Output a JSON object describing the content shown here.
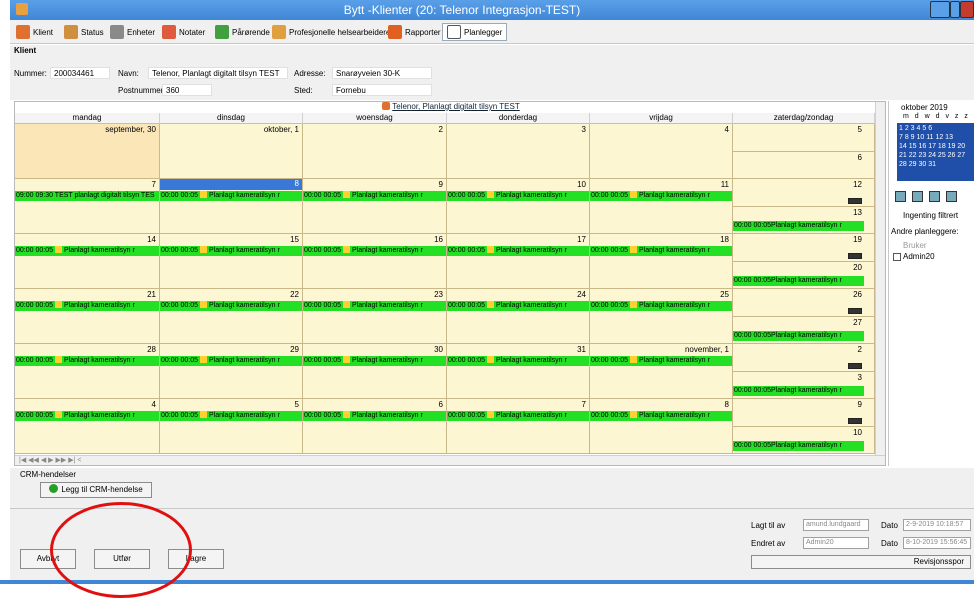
{
  "window": {
    "title": "Bytt -Klienter (20: Telenor Integrasjon-TEST)"
  },
  "tabs": [
    {
      "label": "Klient",
      "icon": "person-icon"
    },
    {
      "label": "Status",
      "icon": "status-icon"
    },
    {
      "label": "Enheter",
      "icon": "devices-icon"
    },
    {
      "label": "Notater",
      "icon": "notes-icon"
    },
    {
      "label": "Pårørende",
      "icon": "relatives-icon"
    },
    {
      "label": "Profesjonelle helsearbeidere",
      "icon": "health-workers-icon"
    },
    {
      "label": "Rapporter",
      "icon": "reports-icon"
    },
    {
      "label": "Planlegger",
      "icon": "calendar-icon"
    }
  ],
  "client": {
    "section_label": "Klient",
    "number_label": "Nummer:",
    "number": "200034461",
    "name_label": "Navn:",
    "name": "Telenor, Planlagt digitalt tilsyn TEST",
    "address_label": "Adresse:",
    "address": "Snarøyveien 30-K",
    "postnr_label": "Postnummer:",
    "postnr": "360",
    "place_label": "Sted:",
    "place": "Fornebu"
  },
  "calendar": {
    "title": "Telenor, Planlagt digitalt tilsyn TEST",
    "day_headers": [
      "mandag",
      "dinsdag",
      "woensdag",
      "donderdag",
      "vrijdag",
      "zaterdag/zondag"
    ],
    "event_text": "00:00 00:05",
    "event_label": "Planlagt kameratilsyn r",
    "first_event": "09:00 09:30 TEST planlagt digitalt tilsyn TES",
    "weeks": [
      {
        "days": [
          "september, 30",
          "oktober, 1",
          "2",
          "3",
          "4"
        ],
        "sat": "5",
        "sun": "6"
      },
      {
        "days": [
          "7",
          "8",
          "9",
          "10",
          "11"
        ],
        "sat": "12",
        "sun": "13"
      },
      {
        "days": [
          "14",
          "15",
          "16",
          "17",
          "18"
        ],
        "sat": "19",
        "sun": "20"
      },
      {
        "days": [
          "21",
          "22",
          "23",
          "24",
          "25"
        ],
        "sat": "26",
        "sun": "27"
      },
      {
        "days": [
          "28",
          "29",
          "30",
          "31",
          "november, 1"
        ],
        "sat": "2",
        "sun": "3"
      },
      {
        "days": [
          "4",
          "5",
          "6",
          "7",
          "8"
        ],
        "sat": "9",
        "sun": "10"
      }
    ],
    "nav": "|◀ ◀◀ ◀ ▶ ▶▶ ▶| <"
  },
  "right_panel": {
    "month": "oktober 2019",
    "dow": "m d w d v z z",
    "mini_rows": [
      "  1  2  3  4  5  6",
      "7  8  9 10 11 12 13",
      "14 15 16 17 18 19 20",
      "21 22 23 24 25 26 27",
      "28 29 30 31"
    ],
    "filter_label": "Ingenting filtrert",
    "other_planners": "Andre planleggere:",
    "user_header": "Bruker",
    "user": "Admin20"
  },
  "crm": {
    "label": "CRM-hendelser",
    "add_button": "Legg til CRM-hendelse"
  },
  "buttons": {
    "cancel": "Avbryt",
    "execute": "Utfør",
    "save": "Lagre"
  },
  "meta": {
    "added_by_label": "Lagt til av",
    "added_by": "amund.lundgaard",
    "added_date_label": "Dato",
    "added_date": "2-9-2019 10:18:57",
    "changed_by_label": "Endret av",
    "changed_by": "Admin20",
    "changed_date_label": "Dato",
    "changed_date": "8-10-2019 15:56:45",
    "revision_button": "Revisjonsspor"
  }
}
